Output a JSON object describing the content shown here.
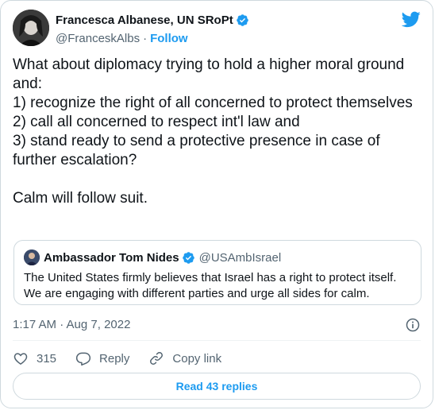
{
  "author": {
    "name": "Francesca Albanese, UN SRoPt",
    "handle": "@FranceskAlbs",
    "separator": "·",
    "follow_label": "Follow"
  },
  "tweet": {
    "lines": [
      "What about diplomacy trying to hold a higher moral ground and:",
      "1) recognize the right of all concerned to protect themselves",
      "2) call all concerned to respect int'l law and",
      "3) stand ready to send a protective presence in case of further escalation?"
    ],
    "closing": "Calm will follow suit."
  },
  "quote": {
    "name": "Ambassador Tom Nides",
    "handle": "@USAmbIsrael",
    "text": "The United States firmly believes that Israel has a right to protect itself. We are engaging with different parties and urge all sides for calm."
  },
  "meta": {
    "timestamp": "1:17 AM · Aug 7, 2022"
  },
  "actions": {
    "like_count": "315",
    "reply_label": "Reply",
    "copy_label": "Copy link"
  },
  "read_replies_label": "Read 43 replies",
  "colors": {
    "accent": "#1d9bf0",
    "like_red": "#f91880",
    "text": "#0f1419",
    "muted": "#536471"
  }
}
